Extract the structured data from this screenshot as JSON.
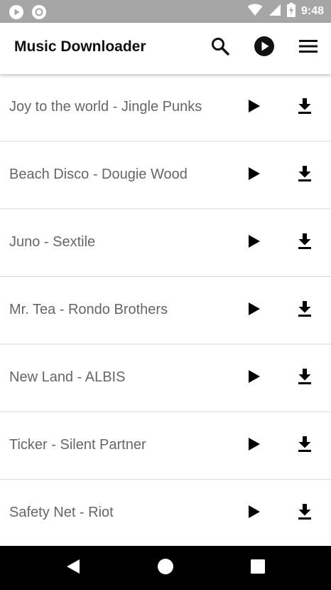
{
  "status_bar": {
    "time": "9:48",
    "left_icons": [
      "play-circle-icon",
      "record-circle-icon"
    ],
    "right_icons": [
      "wifi-icon",
      "signal-icon",
      "battery-charging-icon"
    ],
    "color": "#a6a6a6"
  },
  "app_bar": {
    "title": "Music Downloader",
    "icons": [
      "search-icon",
      "play-circle-icon",
      "menu-icon"
    ]
  },
  "tracks": [
    {
      "title": "Joy to the world - Jingle Punks"
    },
    {
      "title": "Beach Disco - Dougie Wood"
    },
    {
      "title": "Juno - Sextile"
    },
    {
      "title": "Mr. Tea - Rondo Brothers"
    },
    {
      "title": "New Land - ALBIS"
    },
    {
      "title": "Ticker - Silent Partner"
    },
    {
      "title": "Safety Net - Riot"
    }
  ],
  "track_actions": [
    "play-icon",
    "download-icon"
  ],
  "nav_bar": {
    "icons": [
      "back-icon",
      "home-icon",
      "recents-icon"
    ],
    "color": "#000000"
  }
}
